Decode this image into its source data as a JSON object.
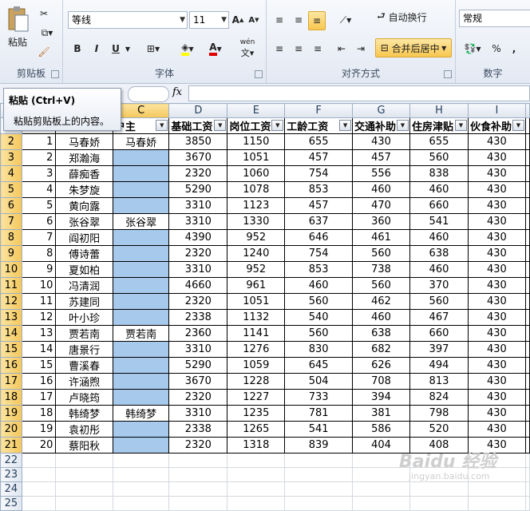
{
  "ribbon": {
    "paste_label": "粘贴",
    "clipboard_label": "剪贴板",
    "font_name": "等线",
    "font_size": "11",
    "font_group_label": "字体",
    "bold": "B",
    "italic": "I",
    "underline": "U",
    "wen": "wén",
    "align_group_label": "对齐方式",
    "wrap_text": "自动换行",
    "merge_center": "合并后居中",
    "number_format": "常规",
    "number_group_label": "数字",
    "percent": "%",
    "comma": ","
  },
  "formula_bar": {
    "fx": "fx"
  },
  "tooltip": {
    "title": "粘贴 (Ctrl+V)",
    "desc": "粘贴剪贴板上的内容。"
  },
  "columns": [
    "C",
    "D",
    "E",
    "F",
    "G",
    "H",
    "I"
  ],
  "headers": [
    "户主",
    "基础工资",
    "岗位工资",
    "工龄工资",
    "交通补助",
    "住房津贴",
    "伙食补助"
  ],
  "rows": [
    {
      "r": "2",
      "idx": "1",
      "name": "马春娇",
      "c": "马春娇",
      "d": "3850",
      "e": "1150",
      "f": "655",
      "g": "430",
      "h": "655",
      "i": "430"
    },
    {
      "r": "3",
      "idx": "2",
      "name": "郑瀚海",
      "c": "",
      "d": "3670",
      "e": "1051",
      "f": "457",
      "g": "457",
      "h": "560",
      "i": "430"
    },
    {
      "r": "4",
      "idx": "3",
      "name": "薛痴香",
      "c": "",
      "d": "2320",
      "e": "1060",
      "f": "754",
      "g": "556",
      "h": "838",
      "i": "430"
    },
    {
      "r": "5",
      "idx": "4",
      "name": "朱梦旋",
      "c": "",
      "d": "5290",
      "e": "1078",
      "f": "853",
      "g": "460",
      "h": "460",
      "i": "430"
    },
    {
      "r": "6",
      "idx": "5",
      "name": "黄向露",
      "c": "",
      "d": "3310",
      "e": "1123",
      "f": "457",
      "g": "470",
      "h": "660",
      "i": "430"
    },
    {
      "r": "7",
      "idx": "6",
      "name": "张谷翠",
      "c": "张谷翠",
      "d": "3310",
      "e": "1330",
      "f": "637",
      "g": "360",
      "h": "541",
      "i": "430"
    },
    {
      "r": "8",
      "idx": "7",
      "name": "阎初阳",
      "c": "",
      "d": "4390",
      "e": "952",
      "f": "646",
      "g": "461",
      "h": "460",
      "i": "430"
    },
    {
      "r": "9",
      "idx": "8",
      "name": "傅诗蕾",
      "c": "",
      "d": "2320",
      "e": "1240",
      "f": "754",
      "g": "560",
      "h": "638",
      "i": "430"
    },
    {
      "r": "10",
      "idx": "9",
      "name": "夏如柏",
      "c": "",
      "d": "3310",
      "e": "952",
      "f": "853",
      "g": "738",
      "h": "460",
      "i": "430"
    },
    {
      "r": "11",
      "idx": "10",
      "name": "冯清润",
      "c": "",
      "d": "4660",
      "e": "961",
      "f": "460",
      "g": "560",
      "h": "370",
      "i": "430"
    },
    {
      "r": "12",
      "idx": "11",
      "name": "苏建同",
      "c": "",
      "d": "2320",
      "e": "1051",
      "f": "560",
      "g": "462",
      "h": "560",
      "i": "430"
    },
    {
      "r": "13",
      "idx": "12",
      "name": "叶小珍",
      "c": "",
      "d": "2338",
      "e": "1132",
      "f": "540",
      "g": "460",
      "h": "467",
      "i": "430"
    },
    {
      "r": "14",
      "idx": "13",
      "name": "贾若南",
      "c": "贾若南",
      "d": "2360",
      "e": "1141",
      "f": "560",
      "g": "638",
      "h": "660",
      "i": "430"
    },
    {
      "r": "15",
      "idx": "14",
      "name": "唐景行",
      "c": "",
      "d": "3310",
      "e": "1276",
      "f": "830",
      "g": "682",
      "h": "397",
      "i": "430"
    },
    {
      "r": "16",
      "idx": "15",
      "name": "曹溪春",
      "c": "",
      "d": "5290",
      "e": "1059",
      "f": "645",
      "g": "626",
      "h": "494",
      "i": "430"
    },
    {
      "r": "17",
      "idx": "16",
      "name": "许涵煦",
      "c": "",
      "d": "3670",
      "e": "1228",
      "f": "504",
      "g": "708",
      "h": "813",
      "i": "430"
    },
    {
      "r": "18",
      "idx": "17",
      "name": "卢晓筠",
      "c": "",
      "d": "2320",
      "e": "1227",
      "f": "733",
      "g": "394",
      "h": "824",
      "i": "430"
    },
    {
      "r": "19",
      "idx": "18",
      "name": "韩绮梦",
      "c": "韩绮梦",
      "d": "3310",
      "e": "1235",
      "f": "781",
      "g": "381",
      "h": "798",
      "i": "430"
    },
    {
      "r": "20",
      "idx": "19",
      "name": "袁初彤",
      "c": "",
      "d": "2338",
      "e": "1265",
      "f": "541",
      "g": "586",
      "h": "520",
      "i": "430"
    },
    {
      "r": "21",
      "idx": "20",
      "name": "蔡阳秋",
      "c": "",
      "d": "2320",
      "e": "1318",
      "f": "839",
      "g": "404",
      "h": "408",
      "i": "430"
    }
  ],
  "empty_rows": [
    "22",
    "23",
    "24",
    "25"
  ],
  "watermark": {
    "logo": "Baidu 经验",
    "url": "jingyan.baidu.com"
  }
}
